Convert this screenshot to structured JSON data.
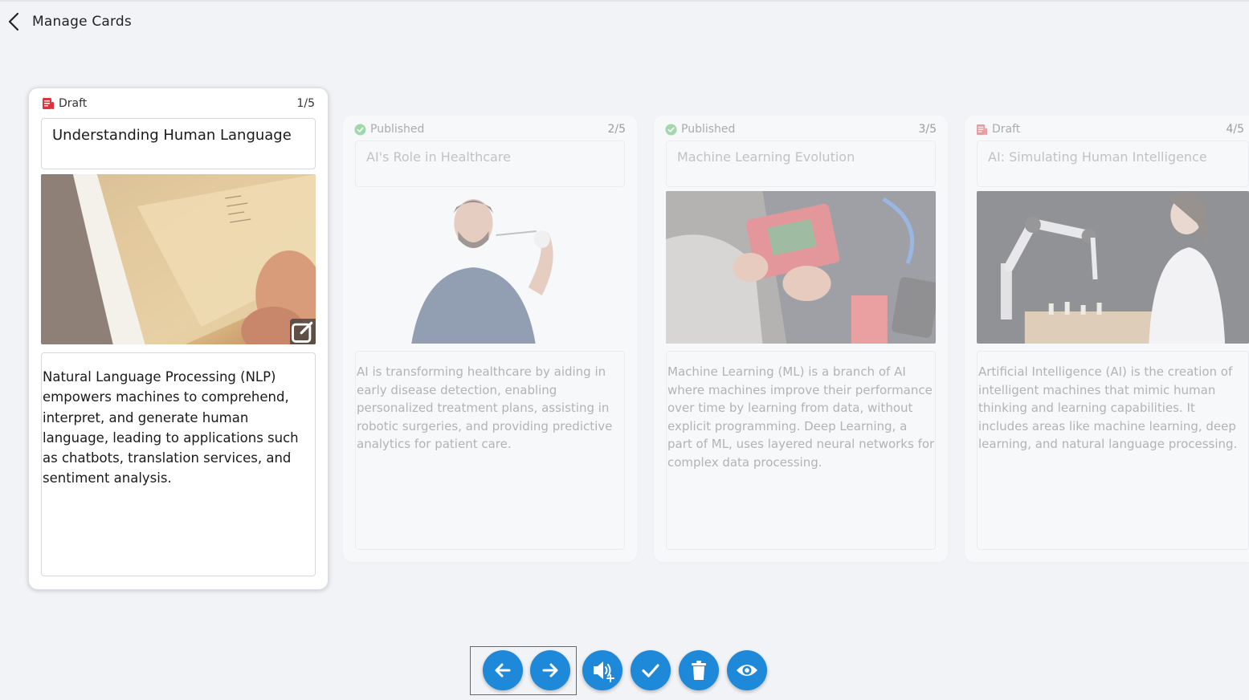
{
  "header": {
    "title": "Manage Cards"
  },
  "cards": [
    {
      "status": "Draft",
      "counter": "1/5",
      "title": "Understanding Human Language",
      "description": "Natural Language Processing (NLP) empowers machines to comprehend, interpret, and generate human language, leading to applications such as chatbots, translation services, and sentiment analysis."
    },
    {
      "status": "Published",
      "counter": "2/5",
      "title": "AI's Role in Healthcare",
      "description": "AI is transforming healthcare by aiding in early disease detection, enabling personalized treatment plans, assisting in robotic surgeries, and providing predictive analytics for patient care."
    },
    {
      "status": "Published",
      "counter": "3/5",
      "title": "Machine Learning Evolution",
      "description": "Machine Learning (ML) is a branch of AI where machines improve their performance over time by learning from data, without explicit programming. Deep Learning, a part of ML, uses layered neural networks for complex data processing."
    },
    {
      "status": "Draft",
      "counter": "4/5",
      "title": "AI: Simulating Human Intelligence",
      "description": "Artificial Intelligence (AI) is the creation of intelligent machines that mimic human thinking and learning capabilities. It includes areas like machine learning, deep learning, and natural language processing."
    }
  ],
  "colors": {
    "accent": "#1e88d9",
    "draft": "#e0323c",
    "published": "#3fb950",
    "highlight": "#e0323c"
  },
  "icons": {
    "back": "chevron-left-icon",
    "draft": "document-icon",
    "published": "check-circle-icon",
    "edit": "edit-icon",
    "prev": "arrow-left-icon",
    "next": "arrow-right-icon",
    "audio": "speaker-plus-icon",
    "approve": "check-icon",
    "delete": "trash-icon",
    "preview": "eye-icon"
  }
}
